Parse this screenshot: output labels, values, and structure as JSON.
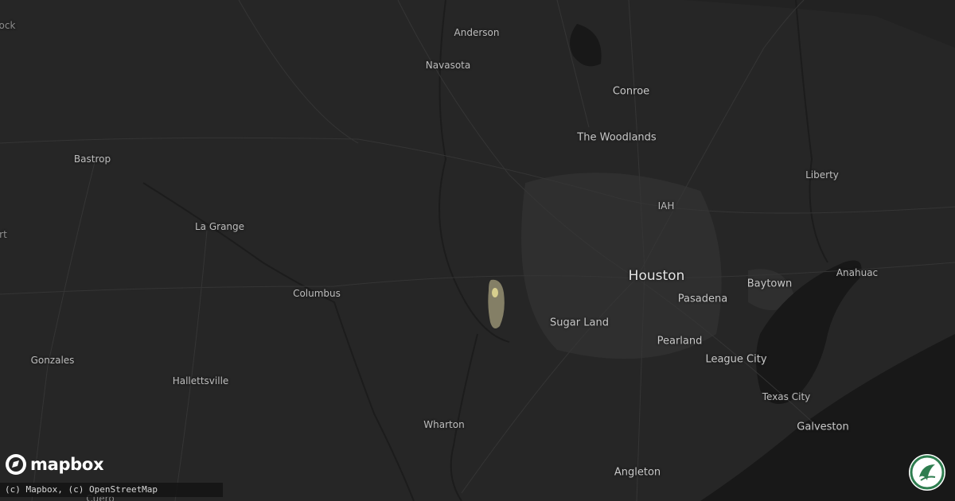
{
  "map": {
    "labels": [
      {
        "id": "anderson",
        "text": "Anderson",
        "size": "small"
      },
      {
        "id": "navasota",
        "text": "Navasota",
        "size": "small"
      },
      {
        "id": "conroe",
        "text": "Conroe",
        "size": "mid"
      },
      {
        "id": "the-woodlands",
        "text": "The Woodlands",
        "size": "mid"
      },
      {
        "id": "bastrop",
        "text": "Bastrop",
        "size": "small"
      },
      {
        "id": "la-grange",
        "text": "La Grange",
        "size": "small"
      },
      {
        "id": "liberty",
        "text": "Liberty",
        "size": "small"
      },
      {
        "id": "iah",
        "text": "IAH",
        "size": "small"
      },
      {
        "id": "houston",
        "text": "Houston",
        "size": "big"
      },
      {
        "id": "baytown",
        "text": "Baytown",
        "size": "mid"
      },
      {
        "id": "anahuac",
        "text": "Anahuac",
        "size": "small"
      },
      {
        "id": "pasadena",
        "text": "Pasadena",
        "size": "mid"
      },
      {
        "id": "columbus",
        "text": "Columbus",
        "size": "small"
      },
      {
        "id": "sugar-land",
        "text": "Sugar Land",
        "size": "mid"
      },
      {
        "id": "pearland",
        "text": "Pearland",
        "size": "mid"
      },
      {
        "id": "league-city",
        "text": "League City",
        "size": "mid"
      },
      {
        "id": "gonzales",
        "text": "Gonzales",
        "size": "small"
      },
      {
        "id": "hallettsville",
        "text": "Hallettsville",
        "size": "small"
      },
      {
        "id": "texas-city",
        "text": "Texas City",
        "size": "small"
      },
      {
        "id": "galveston",
        "text": "Galveston",
        "size": "mid"
      },
      {
        "id": "wharton",
        "text": "Wharton",
        "size": "small"
      },
      {
        "id": "angleton",
        "text": "Angleton",
        "size": "mid"
      },
      {
        "id": "cuero",
        "text": "Cuero",
        "size": "small"
      },
      {
        "id": "ock",
        "text": "ock",
        "size": "small"
      },
      {
        "id": "rt",
        "text": "rt",
        "size": "small"
      }
    ],
    "hail_swath": {
      "color_outer": "#8f8a6e",
      "color_inner": "#d8cf8e"
    }
  },
  "logo": {
    "text": "mapbox",
    "icon": "mapbox-compass-icon"
  },
  "attribution": "(c) Mapbox, (c) OpenStreetMap",
  "brand_badge": {
    "icon": "leaf-swirl-icon",
    "ring_color": "#2e7d4f"
  },
  "colors": {
    "background": "#262626",
    "water": "#161616",
    "road": "#3a3a3a",
    "urban": "#303030"
  }
}
